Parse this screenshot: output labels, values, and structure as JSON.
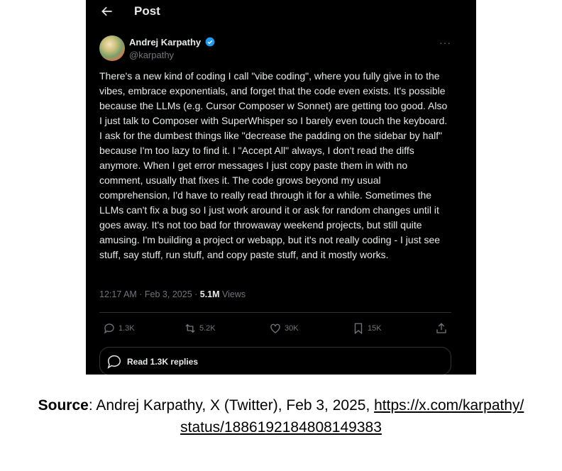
{
  "header": {
    "title": "Post"
  },
  "author": {
    "name": "Andrej Karpathy",
    "handle": "@karpathy"
  },
  "post": {
    "text": "There's a new kind of coding I call \"vibe coding\", where you fully give in to the vibes, embrace exponentials, and forget that the code even exists. It's possible because the LLMs (e.g. Cursor Composer w Sonnet) are getting too good. Also I just talk to Composer with SuperWhisper so I barely even touch the keyboard. I ask for the dumbest things like \"decrease the padding on the sidebar by half\" because I'm too lazy to find it. I \"Accept All\" always, I don't read the diffs anymore. When I get error messages I just copy paste them in with no comment, usually that fixes it. The code grows beyond my usual comprehension, I'd have to really read through it for a while. Sometimes the LLMs can't fix a bug so I just work around it or ask for random changes until it goes away. It's not too bad for throwaway weekend projects, but still quite amusing. I'm building a project or webapp, but it's not really coding - I just see stuff, say stuff, run stuff, and copy paste stuff, and it mostly works.",
    "time": "12:17 AM · Feb 3, 2025 · ",
    "views_count": "5.1M",
    "views_label": " Views"
  },
  "actions": {
    "replies": "1.3K",
    "reposts": "5.2K",
    "likes": "30K",
    "bookmarks": "15K"
  },
  "read_replies": "Read 1.3K replies",
  "caption": {
    "source_label": "Source",
    "text": ": Andrej Karpathy, X (Twitter), Feb 3, 2025, ",
    "link_line1": "https://x.com/karpathy/",
    "link_line2": "status/1886192184808149383"
  },
  "colors": {
    "background": "#000000",
    "text": "#e7e9ea",
    "muted": "#71767b",
    "verified": "#1d9bf0",
    "border": "#2f3336"
  },
  "icons": [
    "back-arrow-icon",
    "verified-badge-icon",
    "more-icon",
    "reply-icon",
    "repost-icon",
    "like-icon",
    "bookmark-icon",
    "share-icon",
    "replies-bubble-icon"
  ]
}
